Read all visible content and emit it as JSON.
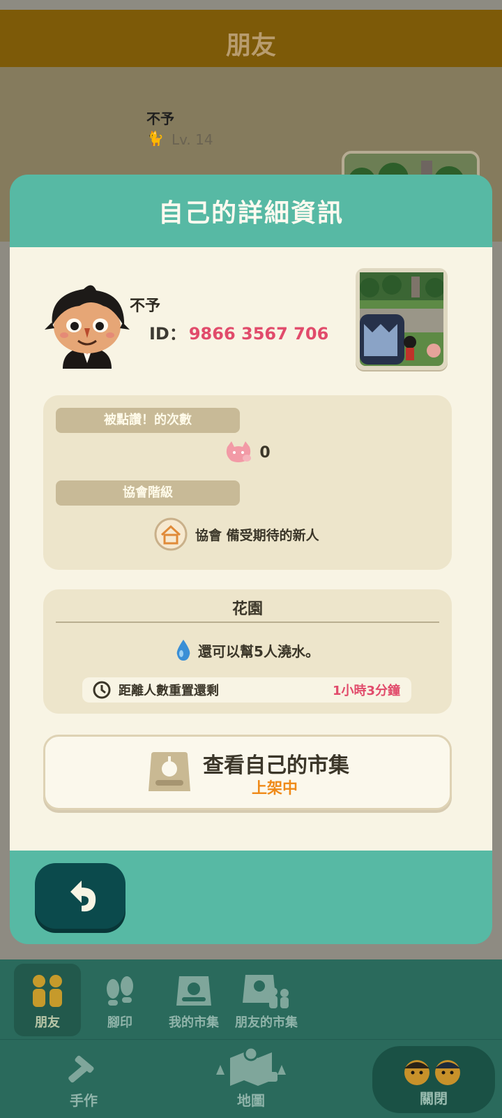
{
  "background": {
    "header_title": "朋友",
    "friend_name": "不予",
    "friend_level": "Lv. 14"
  },
  "modal": {
    "title": "自己的詳細資訊",
    "player_name": "不予",
    "id_label": "ID：",
    "id_value": "9866 3567 706",
    "likes_label": "被點讚！的次數",
    "likes_count": "0",
    "rank_label": "協會階級",
    "rank_value": "協會 備受期待的新人",
    "garden": {
      "title": "花園",
      "watering_text": "還可以幫5人澆水。",
      "reset_label": "距離人數重置還剩",
      "reset_time": "1小時3分鐘"
    },
    "market_button": {
      "label": "查看自己的市集",
      "status": "上架中"
    }
  },
  "nav": {
    "tabs": [
      {
        "label": "朋友",
        "icon": "friends-icon",
        "active": true
      },
      {
        "label": "腳印",
        "icon": "footprints-icon",
        "active": false
      },
      {
        "label": "我的市集",
        "icon": "my-market-icon",
        "active": false
      },
      {
        "label": "朋友的市集",
        "icon": "friends-market-icon",
        "active": false
      }
    ],
    "bottom": [
      {
        "label": "手作",
        "icon": "craft-icon"
      },
      {
        "label": "地圖",
        "icon": "map-icon"
      },
      {
        "label": "關閉",
        "icon": "close-avatars-icon"
      }
    ]
  },
  "colors": {
    "teal": "#57b9a4",
    "cream": "#f8f4e4",
    "accent_pink": "#e14b6b",
    "accent_orange": "#ef8a18",
    "dark_teal": "#0b4a4c"
  }
}
